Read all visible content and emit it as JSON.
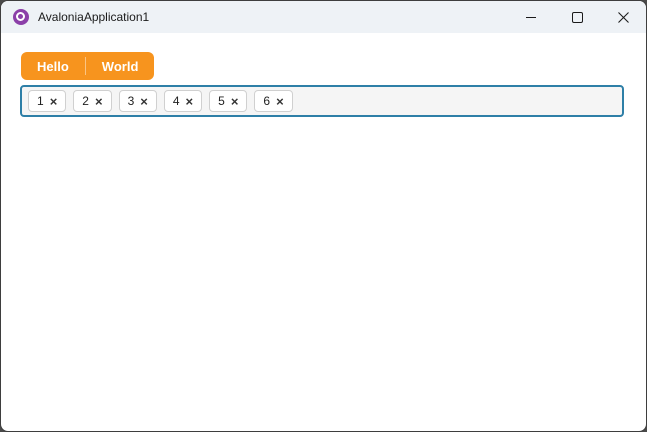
{
  "window": {
    "title": "AvaloniaApplication1"
  },
  "icons": {
    "app_icon": "avalonia-logo",
    "minimize": "minimize-line",
    "maximize": "maximize-square",
    "close": "close-x",
    "chip_remove": "×"
  },
  "tabs": [
    {
      "label": "Hello"
    },
    {
      "label": "World"
    }
  ],
  "chips": [
    {
      "label": "1"
    },
    {
      "label": "2"
    },
    {
      "label": "3"
    },
    {
      "label": "4"
    },
    {
      "label": "5"
    },
    {
      "label": "6"
    }
  ],
  "colors": {
    "accent_orange": "#F7941E",
    "chipbox_border": "#2E7FA7",
    "titlebar_bg": "#EEF2F6",
    "logo_purple": "#8B3FA8",
    "window_border": "#3E3E3E"
  }
}
